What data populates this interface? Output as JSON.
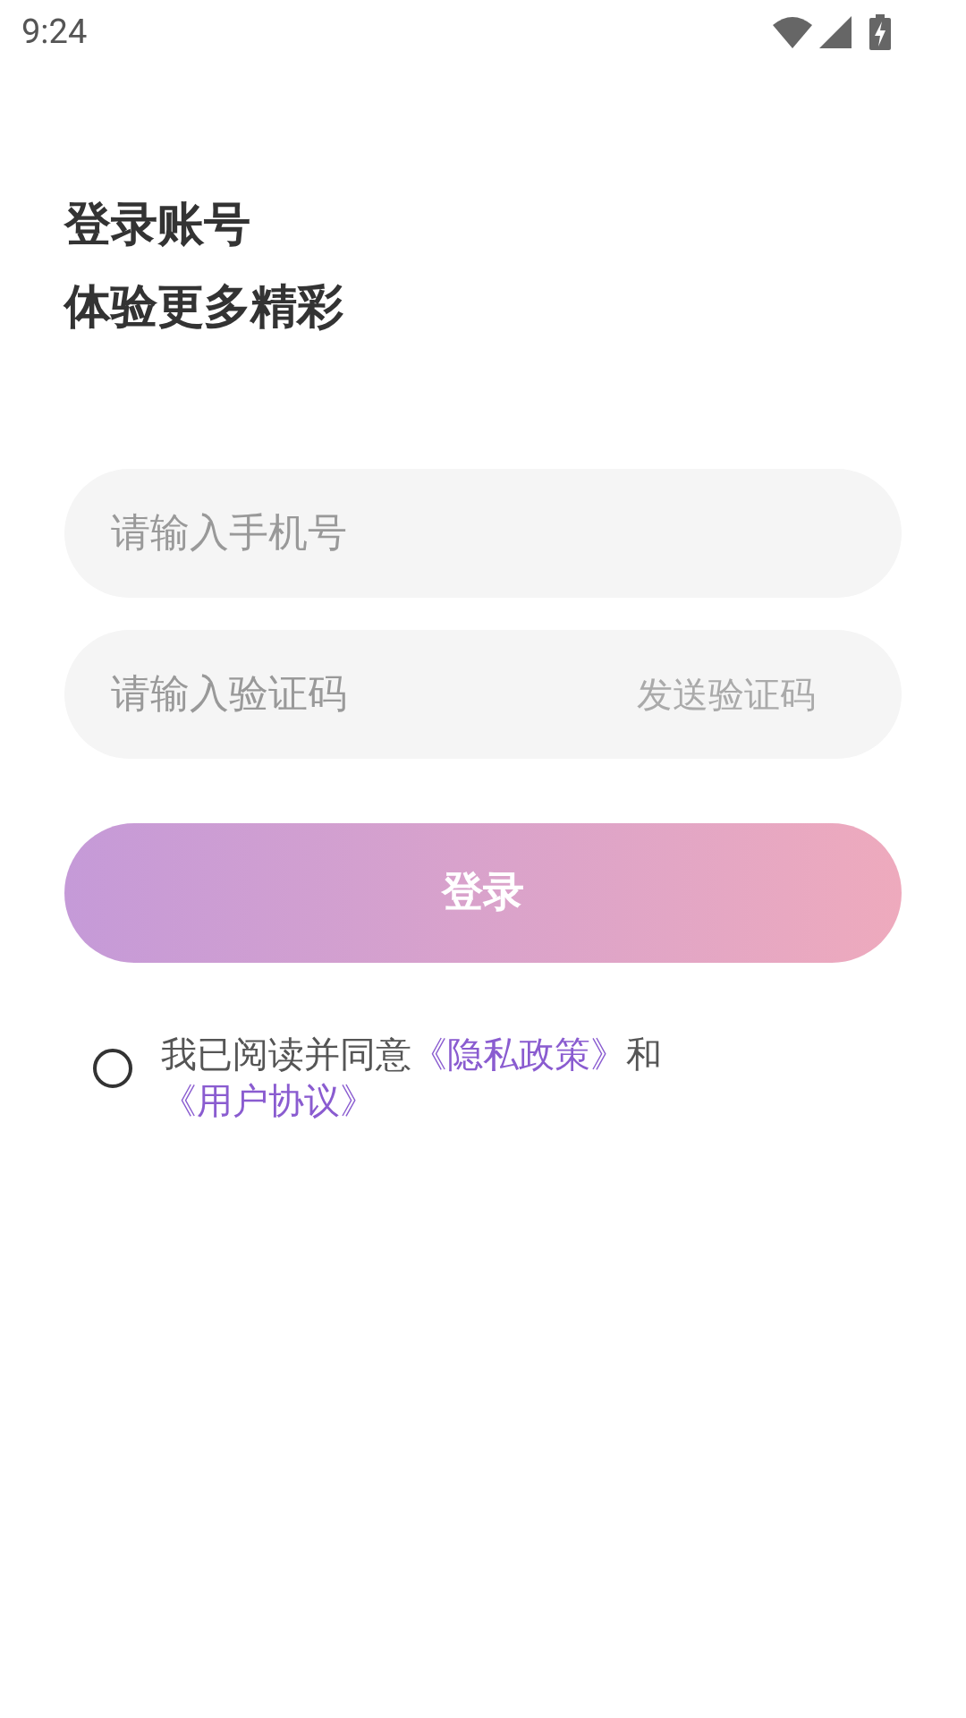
{
  "status_bar": {
    "time": "9:24"
  },
  "heading": {
    "title": "登录账号",
    "subtitle": "体验更多精彩"
  },
  "phone_field": {
    "placeholder": "请输入手机号"
  },
  "code_field": {
    "placeholder": "请输入验证码",
    "send_code": "发送验证码"
  },
  "login_button": {
    "label": "登录",
    "disabled": true
  },
  "agreement": {
    "checked": false,
    "prefix": "我已阅读并同意",
    "privacy_link": "《隐私政策》",
    "conjunction": "和",
    "terms_link": "《用户协议》"
  }
}
